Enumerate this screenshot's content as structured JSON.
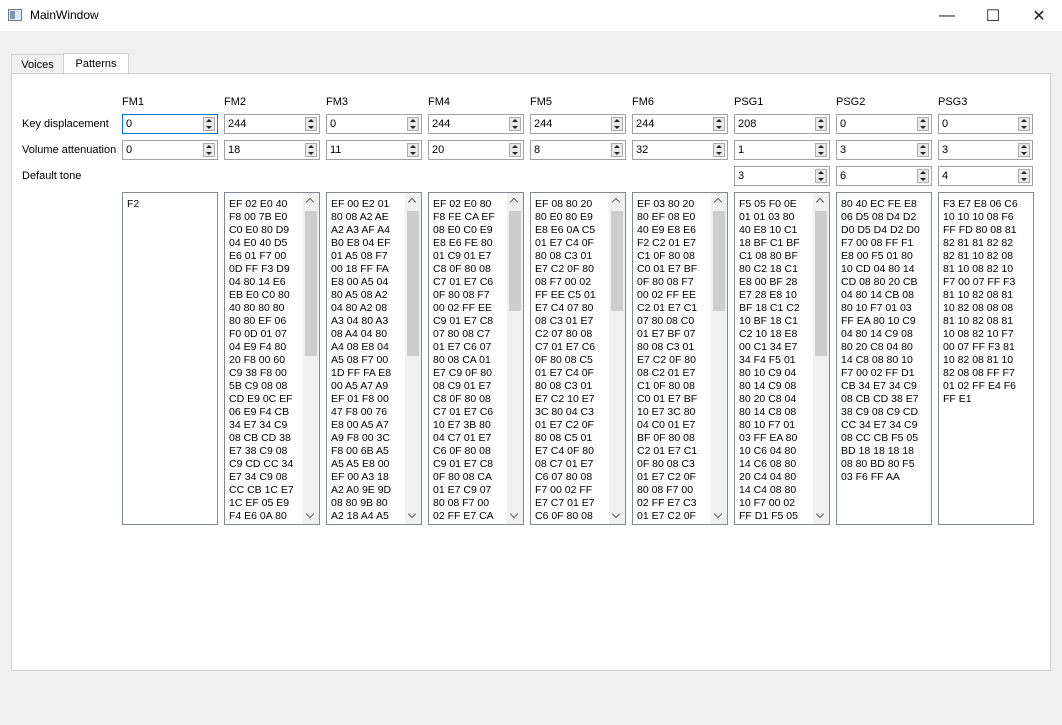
{
  "window": {
    "title": "MainWindow",
    "minimize": "—",
    "maximize": "☐",
    "close": "✕"
  },
  "tabs": [
    {
      "label": "Voices",
      "active": false
    },
    {
      "label": "Patterns",
      "active": true
    }
  ],
  "row_labels": {
    "key_displacement": "Key displacement",
    "volume_attenuation": "Volume attenuation",
    "default_tone": "Default tone"
  },
  "channels": [
    {
      "name": "FM1",
      "key": "0",
      "volume": "0",
      "tone": null,
      "pattern": "F2"
    },
    {
      "name": "FM2",
      "key": "244",
      "volume": "18",
      "tone": null,
      "pattern": "EF 02 E0 40\nF8 00 7B E0\nC0 E0 80 D9\n04 E0 40 D5\nE6 01 F7 00\n0D FF F3 D9\n04 80 14 E6\nEB E0 C0 80\n40 80 80 80\n80 80 EF 06\nF0 0D 01 07\n04 E9 F4 80\n20 F8 00 60\nC9 38 F8 00\n5B C9 08 08\nCD E9 0C EF\n06 E9 F4 CB\n34 E7 34 C9\n08 CB CD 38\nE7 38 C9 08\nC9 CD CC 34\nE7 34 C9 08\nCC CB 1C E7\n1C EF 05 E9\nF4 E6 0A 80"
    },
    {
      "name": "FM3",
      "key": "0",
      "volume": "11",
      "tone": null,
      "pattern": "EF 00 E2 01\n80 08 A2 AE\nA2 A3 AF A4\nB0 E8 04 EF\n01 A5 08 F7\n00 18 FF FA\nE8 00 A5 04\n80 A5 08 A2\n04 80 A2 08\nA3 04 80 A3\n08 A4 04 80\nA4 08 E8 04\nA5 08 F7 00\n1D FF FA E8\n00 A5 A7 A9\nEF 01 F8 00\n47 F8 00 76\nE8 00 A5 A7\nA9 F8 00 3C\nF8 00 6B A5\nA5 A5 E8 00\nEF 00 A3 18\nA2 A0 9E 9D\n08 80 9B 80\nA2 18 A4 A5"
    },
    {
      "name": "FM4",
      "key": "244",
      "volume": "20",
      "tone": null,
      "pattern": "EF 02 E0 80\nF8 FE CA EF\n08 E0 C0 E9\nE8 E6 FE 80\n01 C9 01 E7\nC8 0F 80 08\nC7 01 E7 C6\n0F 80 08 F7\n00 02 FF EE\nC9 01 E7 C8\n07 80 08 C7\n01 E7 C6 07\n80 08 CA 01\nE7 C9 0F 80\n08 C9 01 E7\nC8 0F 80 08\nC7 01 E7 C6\n10 E7 3B 80\n04 C7 01 E7\nC6 0F 80 08\nC9 01 E7 C8\n0F 80 08 CA\n01 E7 C9 07\n80 08 F7 00\n02 FF E7 CA"
    },
    {
      "name": "FM5",
      "key": "244",
      "volume": "8",
      "tone": null,
      "pattern": "EF 08 80 20\n80 E0 80 E9\nE8 E6 0A C5\n01 E7 C4 0F\n80 08 C3 01\nE7 C2 0F 80\n08 F7 00 02\nFF EE C5 01\nE7 C4 07 80\n08 C3 01 E7\nC2 07 80 08\nC7 01 E7 C6\n0F 80 08 C5\n01 E7 C4 0F\n80 08 C3 01\nE7 C2 10 E7\n3C 80 04 C3\n01 E7 C2 0F\n80 08 C5 01\nE7 C4 0F 80\n08 C7 01 E7\nC6 07 80 08\nF7 00 02 FF\nE7 C7 01 E7\nC6 0F 80 08"
    },
    {
      "name": "FM6",
      "key": "244",
      "volume": "32",
      "tone": null,
      "pattern": "EF 03 80 20\n80 EF 08 E0\n40 E9 E8 E6\nF2 C2 01 E7\nC1 0F 80 08\nC0 01 E7 BF\n0F 80 08 F7\n00 02 FF EE\nC2 01 E7 C1\n07 80 08 C0\n01 E7 BF 07\n80 08 C3 01\nE7 C2 0F 80\n08 C2 01 E7\nC1 0F 80 08\nC0 01 E7 BF\n10 E7 3C 80\n04 C0 01 E7\nBF 0F 80 08\nC2 01 E7 C1\n0F 80 08 C3\n01 E7 C2 0F\n80 08 F7 00\n02 FF E7 C3\n01 E7 C2 0F"
    },
    {
      "name": "PSG1",
      "key": "208",
      "volume": "1",
      "tone": "3",
      "pattern": "F5 05 F0 0E\n01 01 03 80\n40 E8 10 C1\n18 BF C1 BF\nC1 08 80 BF\n80 C2 18 C1\nE8 00 BF 28\nE7 28 E8 10\nBF 18 C1 C2\n10 BF 18 C1\nC2 10 18 E8\n00 C1 34 E7\n34 F4 F5 01\n80 10 C9 04\n80 14 C9 08\n80 20 C8 04\n80 14 C8 08\n80 10 F7 01\n03 FF EA 80\n10 C6 04 80\n14 C6 08 80\n20 C4 04 80\n14 C4 08 80\n10 F7 00 02\nFF D1 F5 05"
    },
    {
      "name": "PSG2",
      "key": "0",
      "volume": "3",
      "tone": "6",
      "pattern": "80 40 EC FE E8\n06 D5 08 D4 D2\nD0 D5 D4 D2 D0\nF7 00 08 FF F1\nE8 00 F5 01 80\n10 CD 04 80 14\nCD 08 80 20 CB\n04 80 14 CB 08\n80 10 F7 01 03\nFF EA 80 10 C9\n04 80 14 C9 08\n80 20 C8 04 80\n14 C8 08 80 10\nF7 00 02 FF D1\nCB 34 E7 34 C9\n08 CB CD 38 E7\n38 C9 08 C9 CD\nCC 34 E7 34 C9\n08 CC CB F5 05\nBD 18 18 18 18\n08 80 BD 80 F5\n03 F6 FF AA"
    },
    {
      "name": "PSG3",
      "key": "0",
      "volume": "3",
      "tone": "4",
      "pattern": "F3 E7 E8 06 C6\n10 10 10 08 F6\nFF FD 80 08 81\n82 81 81 82 82\n82 81 10 82 08\n81 10 08 82 10\nF7 00 07 FF F3\n81 10 82 08 81\n10 82 08 08 08\n81 10 82 08 81\n10 08 82 10 F7\n00 07 FF F3 81\n10 82 08 81 10\n82 08 08 FF F7\n01 02 FF E4 F6\nFF E1"
    }
  ]
}
